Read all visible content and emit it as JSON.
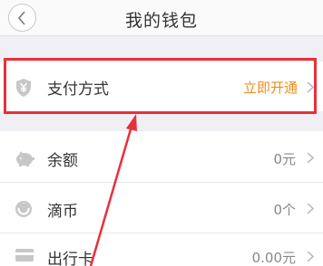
{
  "header": {
    "title": "我的钱包"
  },
  "payment": {
    "label": "支付方式",
    "action": "立即开通"
  },
  "items": [
    {
      "label": "余额",
      "value": "0元",
      "icon": "piggy-bank-icon"
    },
    {
      "label": "滴币",
      "value": "0个",
      "icon": "didi-coin-icon"
    },
    {
      "label": "出行卡",
      "value": "0.00元",
      "icon": "travel-card-icon"
    }
  ],
  "colors": {
    "accent": "#f28c1c",
    "highlight": "#e8303a",
    "icon": "#c7c7c7",
    "background": "#efeff4"
  }
}
